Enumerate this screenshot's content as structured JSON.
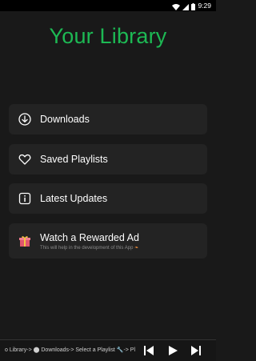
{
  "status_bar": {
    "time": "9:29",
    "icons": [
      "wifi-icon",
      "signal-icon",
      "battery-icon"
    ]
  },
  "page": {
    "title": "Your Library"
  },
  "menu": {
    "downloads": {
      "label": "Downloads",
      "icon": "download-icon"
    },
    "saved_playlists": {
      "label": "Saved Playlists",
      "icon": "heart-icon"
    },
    "latest_updates": {
      "label": "Latest Updates",
      "icon": "info-icon"
    },
    "rewarded_ad": {
      "label": "Watch a Rewarded Ad",
      "subtitle": "This will help in the development of this App",
      "icon": "gift-icon"
    }
  },
  "player": {
    "marquee_text": "o Library-> ⬤ Downloads-> Select a Playlist 🔧-> Pl",
    "controls": [
      "skip-previous-icon",
      "play-icon",
      "skip-next-icon"
    ]
  },
  "colors": {
    "accent": "#1db954",
    "background": "#191919",
    "card": "#232323"
  }
}
